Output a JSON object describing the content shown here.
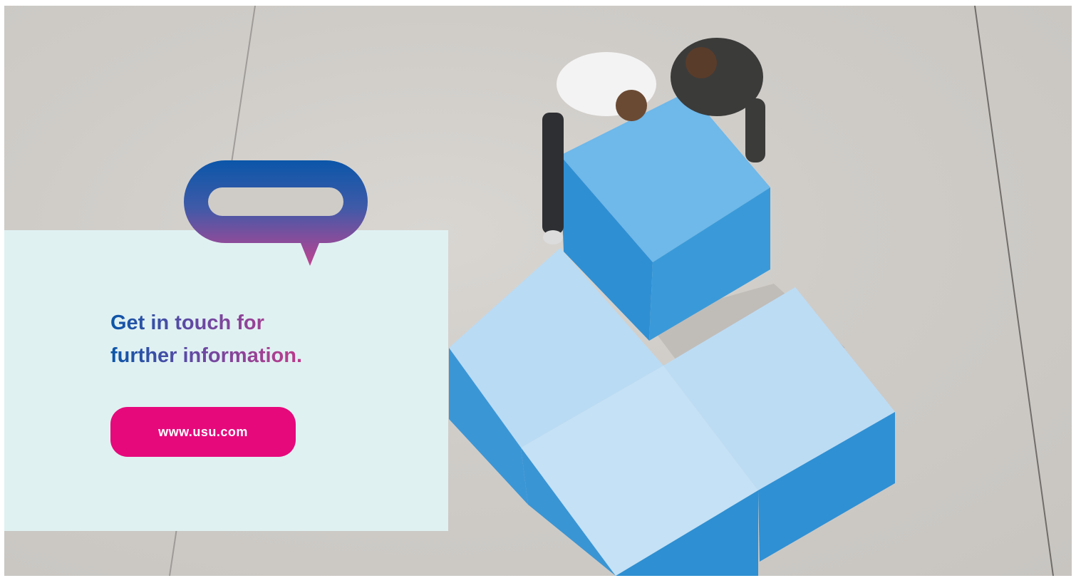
{
  "hero": {
    "image_description_icon": "two-people-pushing-blue-cubes-photo"
  },
  "card": {
    "headline_line1": "Get in touch for",
    "headline_line2": "further information.",
    "cta_label": "www.usu.com"
  },
  "logo": {
    "icon": "speech-bubble-logo-icon"
  },
  "colors": {
    "card_background": "#e0f1f2",
    "cta_background": "#e6097c",
    "gradient_start": "#0a56a8",
    "gradient_end": "#e8127e",
    "cube": "#4aa3dd"
  }
}
